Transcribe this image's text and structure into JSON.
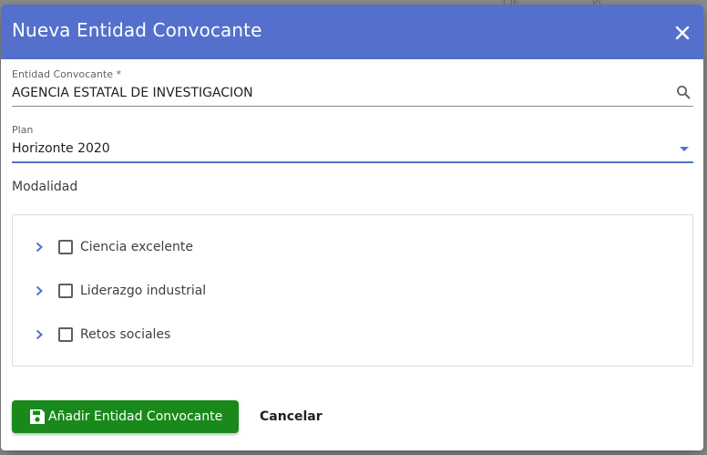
{
  "background": {
    "fragments": [
      "CIF",
      "Pl"
    ]
  },
  "dialog": {
    "title": "Nueva Entidad Convocante",
    "header_color": "#5470cc",
    "close_icon": "close-icon"
  },
  "fields": {
    "entidad": {
      "label": "Entidad Convocante *",
      "value": "AGENCIA ESTATAL DE INVESTIGACION",
      "icon": "search-icon"
    },
    "plan": {
      "label": "Plan",
      "value": "Horizonte 2020",
      "icon": "dropdown-arrow-icon"
    }
  },
  "modalidad": {
    "label": "Modalidad",
    "items": [
      {
        "label": "Ciencia excelente",
        "checked": false
      },
      {
        "label": "Liderazgo industrial",
        "checked": false
      },
      {
        "label": "Retos sociales",
        "checked": false
      }
    ]
  },
  "actions": {
    "save_label": "Añadir Entidad Convocante",
    "save_color": "#19891b",
    "save_icon": "save-icon",
    "cancel_label": "Cancelar"
  }
}
